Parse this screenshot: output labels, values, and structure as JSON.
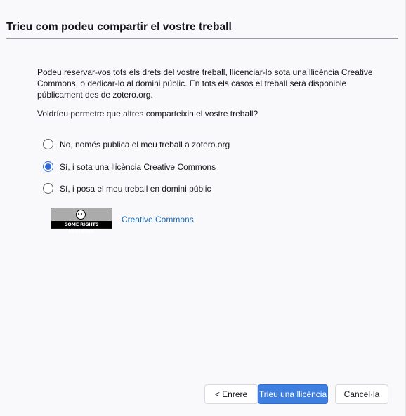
{
  "dialog": {
    "title": "Trieu com podeu compartir el vostre treball",
    "description": "Podeu reservar-vos tots els drets del vostre treball, llicenciar-lo sota una llicència Creative Commons, o dedicar-lo al domini públic. En tots els casos el treball serà disponible públicament des de zotero.org.",
    "question": "Voldríeu permetre que altres comparteixin el vostre treball?"
  },
  "options": [
    {
      "label": "No, només publica el meu treball a zotero.org",
      "checked": false
    },
    {
      "label": "Sí, i sota una llicència Creative Commons",
      "checked": true
    },
    {
      "label": "Sí, i posa el meu treball en domini públic",
      "checked": false
    }
  ],
  "license": {
    "badge_symbol": "cc",
    "badge_text": "SOME RIGHTS RESERVED",
    "link_text": "Creative Commons"
  },
  "buttons": {
    "back_prefix": "< ",
    "back_accesskey": "E",
    "back_rest": "nrere",
    "primary": "Trieu una llicència",
    "cancel": "Cancel·la"
  },
  "colors": {
    "accent": "#2f6bd8",
    "link": "#1a6bb3"
  }
}
